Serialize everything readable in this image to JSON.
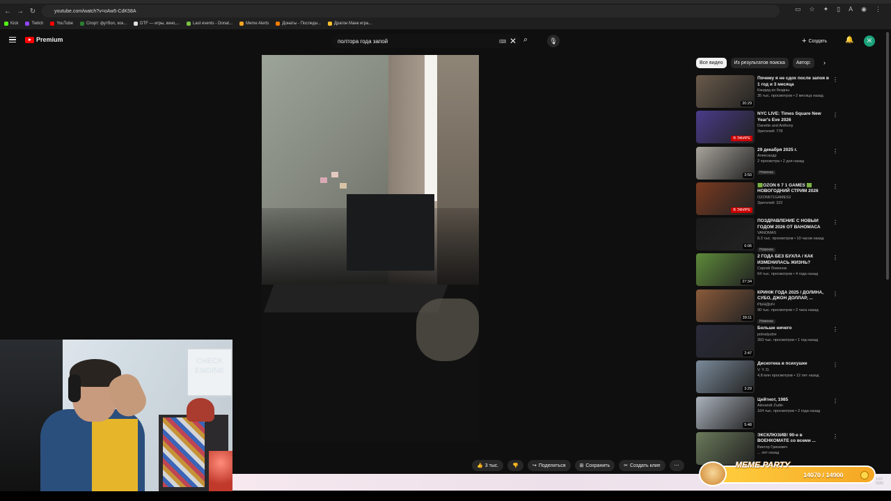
{
  "browser": {
    "url": "youtube.com/watch?v=oAw5-CdK58A",
    "bookmarks": [
      {
        "label": "Kick",
        "color": "#53fc18"
      },
      {
        "label": "Twitch",
        "color": "#9146ff"
      },
      {
        "label": "YouTube",
        "color": "#ff0000"
      },
      {
        "label": "Спорт: футбол, хок...",
        "color": "#2e7d32"
      },
      {
        "label": "DTF — игры, кино,...",
        "color": "#e0e0e0"
      },
      {
        "label": "Last events - Donat...",
        "color": "#7bc043"
      },
      {
        "label": "Meme Alerts",
        "color": "#f5a623"
      },
      {
        "label": "Донаты - Последн...",
        "color": "#f57c00"
      },
      {
        "label": "Драгон Манк игра...",
        "color": "#fbc02d"
      }
    ]
  },
  "youtube": {
    "logo_label": "Premium",
    "search_value": "полтора года запой",
    "create_label": "Создать",
    "avatar_letter": "Ж"
  },
  "actions": {
    "likes": "3 тыс.",
    "share": "Поделиться",
    "save": "Сохранить",
    "clip": "Создать клип"
  },
  "chips": [
    {
      "label": "Все видео",
      "active": true
    },
    {
      "label": "Из результатов поиска",
      "active": false
    },
    {
      "label": "Автор:",
      "active": false
    }
  ],
  "recommendations": [
    {
      "title": "Почему я не сдох после запоя в 1 год и 3 месяца",
      "channel": "Кандид из бездны",
      "stats": "35 тыс. просмотров • 2 месяца назад",
      "badge": "",
      "duration": "20:29",
      "live": false,
      "thumb": "#6a5a4a"
    },
    {
      "title": "NYC LIVE: Times Square New Year's Eve 2026",
      "channel": "Danette and Anthony",
      "stats": "Зрителей: 778",
      "badge": "",
      "duration": "",
      "live": true,
      "thumb": "#4a3b8a"
    },
    {
      "title": "29 декабря 2025 г.",
      "channel": "Александр",
      "stats": "2 просмотра • 2 дня назад",
      "badge": "Новинка",
      "duration": "3:50",
      "live": false,
      "thumb": "#a8a49c"
    },
    {
      "title": "🟩OZON 6 7 1 GAMES 🟩 НОВОГОДНИЙ СТРИМ 2026",
      "channel": "OZON671GAMES3",
      "stats": "Зрителей: 322",
      "badge": "",
      "duration": "",
      "live": true,
      "thumb": "#7a3a20"
    },
    {
      "title": "ПОЗДРАВЛЕНИЕ С НОВЫЙ ГОДОМ 2026 ОТ ВАНОМАСА",
      "channel": "VANOMAS",
      "stats": "8,3 тыс. просмотров • 10 часов назад",
      "badge": "Новинка",
      "duration": "6:06",
      "live": false,
      "thumb": "#1a1a1a"
    },
    {
      "title": "2 ГОДА БЕЗ БУХЛА / КАК ИЗМЕНИЛАСЬ ЖИЗНЬ?",
      "channel": "Сергей Ломонов",
      "stats": "64 тыс. просмотров • 4 года назад",
      "badge": "",
      "duration": "27:34",
      "live": false,
      "thumb": "#5e8a3a"
    },
    {
      "title": "КРИНЖ ГОДА 2025 / ДОЛИНА, СУБО, ДЖОН ДОЛЛАР, ...",
      "channel": "РЫНДЫЧ",
      "stats": "90 тыс. просмотров • 2 часа назад",
      "badge": "Новинка",
      "duration": "39:11",
      "live": false,
      "thumb": "#8a5a3a"
    },
    {
      "title": "Больше ничего",
      "channel": "polnalyubvi",
      "stats": "393 тыс. просмотров • 1 год назад",
      "badge": "",
      "duration": "2:47",
      "live": false,
      "thumb": "#2a2a3a"
    },
    {
      "title": "Дискотека в психушке",
      "channel": "V. Y. D.",
      "stats": "4,8 млн просмотров • 12 лет назад",
      "badge": "",
      "duration": "3:29",
      "live": false,
      "thumb": "#7a8a9a"
    },
    {
      "title": "Цейтнот, 1985",
      "channel": "Alexandr Zudin",
      "stats": "164 тыс. просмотров • 2 года назад",
      "badge": "",
      "duration": "5:48",
      "live": false,
      "thumb": "#aab2bc"
    },
    {
      "title": "ЭКСКЛЮЗИВ! 90-е в ВОЕНКОМАТЕ со всеми ...",
      "channel": "Виктор Гриневич",
      "stats": "... лет назад",
      "badge": "",
      "duration": "",
      "live": false,
      "thumb": "#6a7a5a"
    }
  ],
  "live_label": "В ЭФИРЕ",
  "meme_widget": {
    "title": "MEME PARTY",
    "progress": "14070 / 14900",
    "progress_fraction": 0.944
  },
  "clock": "1:57\n2025"
}
